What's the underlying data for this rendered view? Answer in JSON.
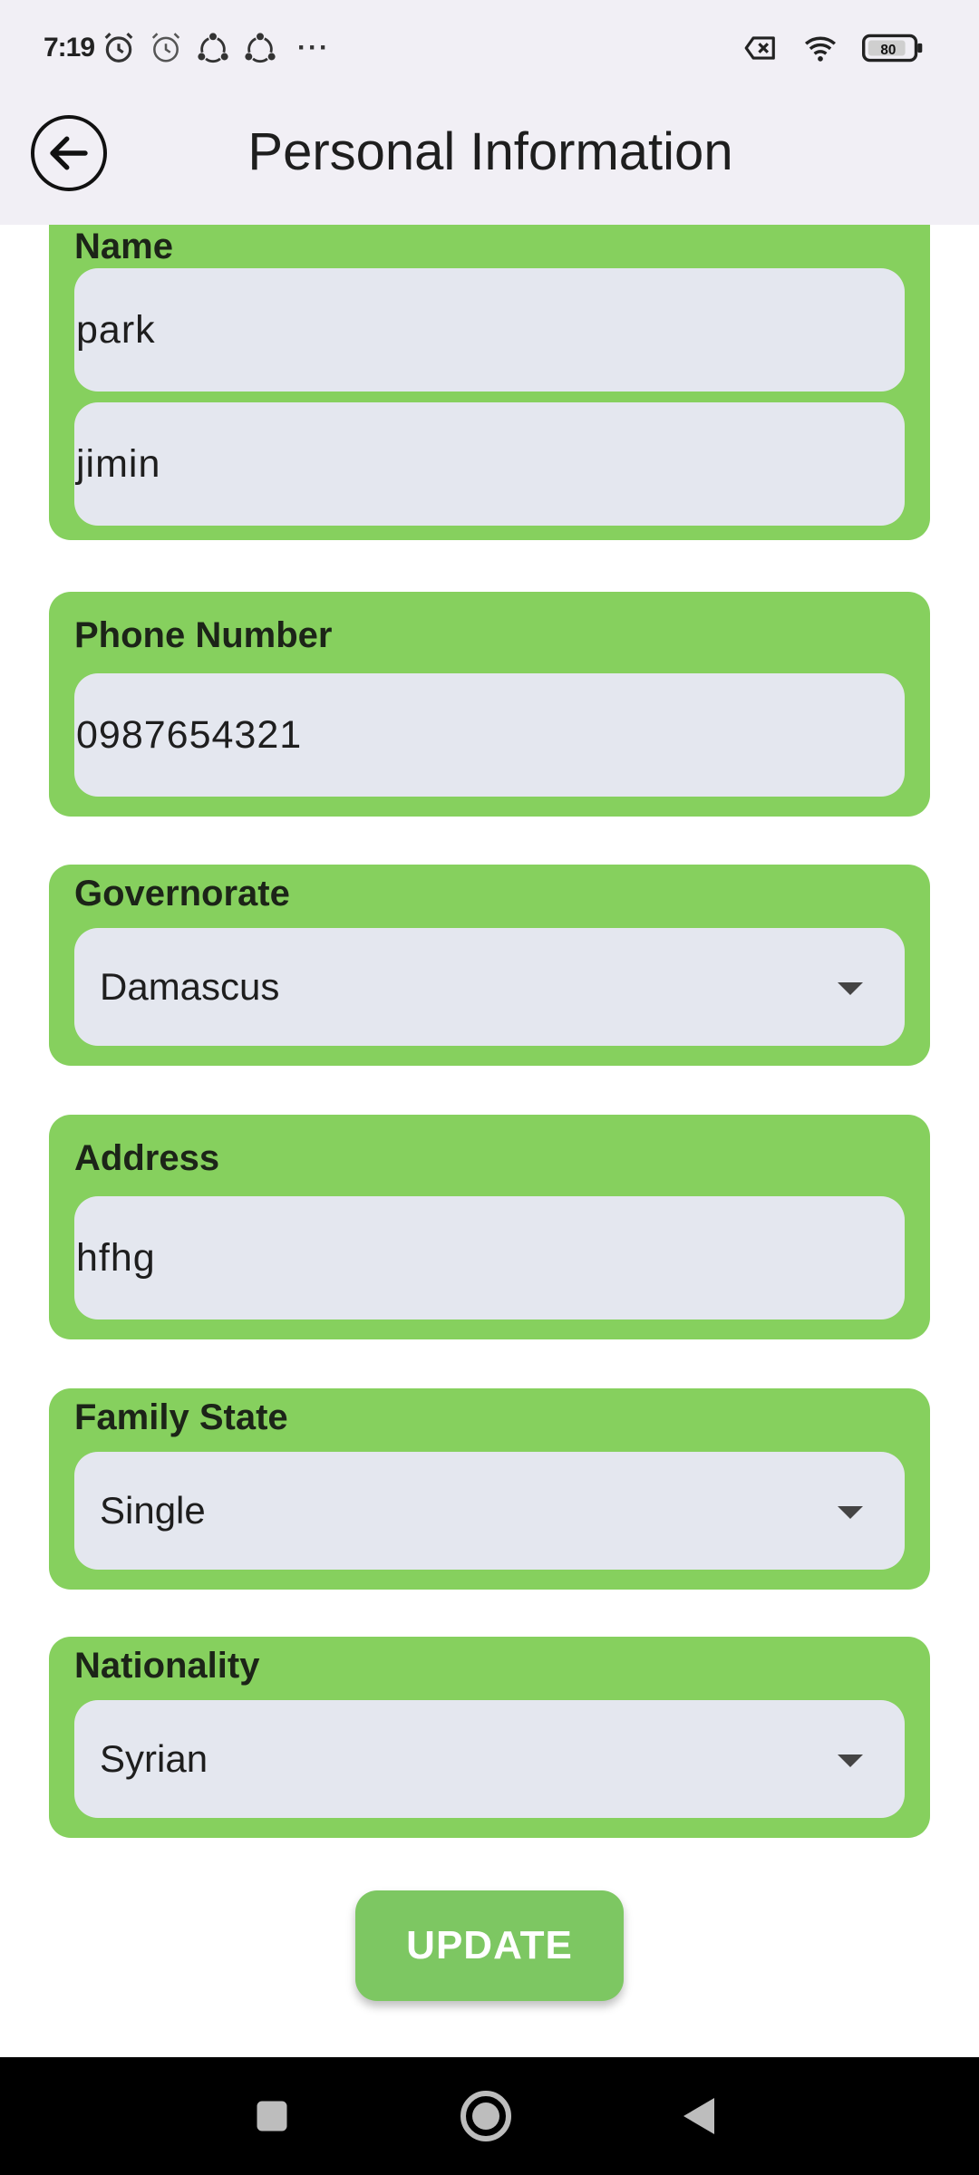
{
  "status_bar": {
    "time": "7:19",
    "overflow_dots": "···",
    "battery_level": "80",
    "icons_left": [
      "alarm-icon",
      "alarm-outline-icon",
      "sync-icon",
      "sync-icon"
    ],
    "icons_right": [
      "sim-off-icon",
      "wifi-icon",
      "battery-icon"
    ]
  },
  "appbar": {
    "title": "Personal Information",
    "back_icon": "arrow-left-circle-icon"
  },
  "form": {
    "name": {
      "label": "Name",
      "first": "park",
      "last": "jimin"
    },
    "phone": {
      "label": "Phone Number",
      "value": "0987654321"
    },
    "governorate": {
      "label": "Governorate",
      "value": "Damascus"
    },
    "address": {
      "label": "Address",
      "value": "hfhg"
    },
    "family_state": {
      "label": "Family State",
      "value": "Single"
    },
    "nationality": {
      "label": "Nationality",
      "value": "Syrian"
    }
  },
  "actions": {
    "update_label": "UPDATE"
  },
  "colors": {
    "card_green": "#86d05e",
    "field_bg": "#e4e7ef",
    "button_green": "#7dc762",
    "appbar_bg": "#f1eff5"
  },
  "navbar": {
    "icons": [
      "recents-square-icon",
      "home-circle-icon",
      "back-triangle-icon"
    ]
  }
}
